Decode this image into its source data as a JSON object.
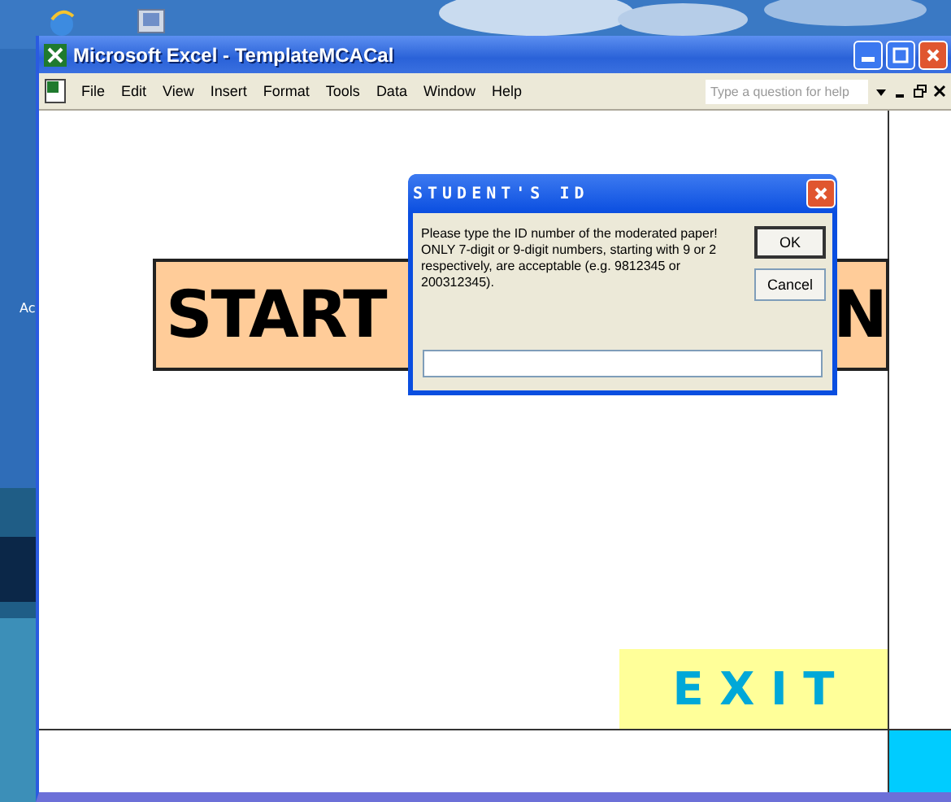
{
  "desktop": {
    "icon_label": "Ac"
  },
  "window": {
    "title": "Microsoft Excel - TemplateMCACal"
  },
  "menu": [
    "File",
    "Edit",
    "View",
    "Insert",
    "Format",
    "Tools",
    "Data",
    "Window",
    "Help"
  ],
  "help_box": {
    "placeholder": "Type a question for help"
  },
  "sheet": {
    "banner": {
      "left_text": "START",
      "right_text": "N"
    },
    "exit_button": "E X I T"
  },
  "dialog": {
    "title": "STUDENT'S ID",
    "message": "Please type the ID number of the moderated paper! ONLY 7-digit or 9-digit numbers, starting with 9 or 2 respectively, are acceptable (e.g. 9812345 or 200312345).",
    "buttons": [
      {
        "label": "OK",
        "selected": true
      },
      {
        "label": "Cancel",
        "selected": false
      }
    ]
  }
}
